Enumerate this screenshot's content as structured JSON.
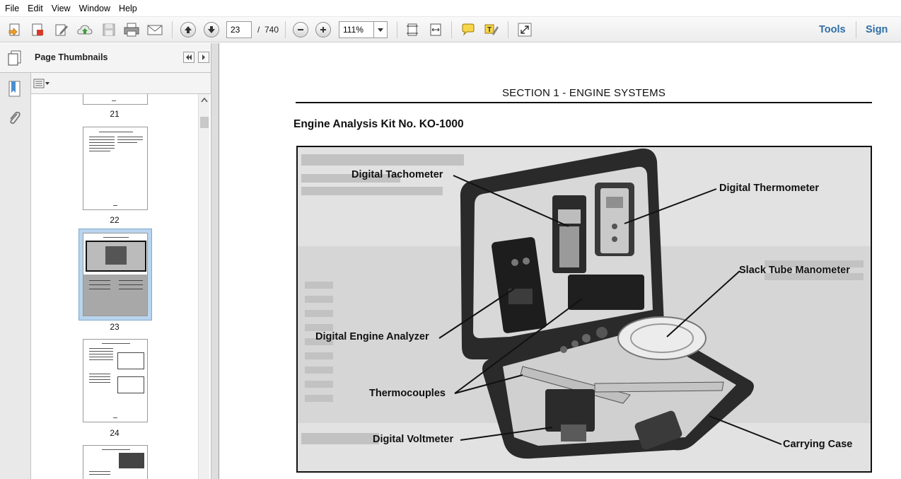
{
  "menu": [
    "File",
    "Edit",
    "View",
    "Window",
    "Help"
  ],
  "toolbar": {
    "page_current": "23",
    "page_separator": "/",
    "page_total": "740",
    "zoom": "111%",
    "tools_label": "Tools",
    "sign_label": "Sign"
  },
  "sidebar": {
    "title": "Page Thumbnails",
    "thumbnails": [
      {
        "label": "21"
      },
      {
        "label": "22"
      },
      {
        "label": "23"
      },
      {
        "label": "24"
      }
    ]
  },
  "document": {
    "section_title": "SECTION 1 - ENGINE SYSTEMS",
    "heading": "Engine Analysis Kit No. KO-1000",
    "figure_callouts": {
      "tachometer": "Digital Tachometer",
      "thermometer": "Digital Thermometer",
      "manometer": "Slack Tube Manometer",
      "engine_analyzer": "Digital Engine Analyzer",
      "thermocouples": "Thermocouples",
      "voltmeter": "Digital Voltmeter",
      "carrying_case": "Carrying Case"
    }
  },
  "colors": {
    "accent": "#2e6da4",
    "selected_thumb": "#b9d4ee"
  }
}
